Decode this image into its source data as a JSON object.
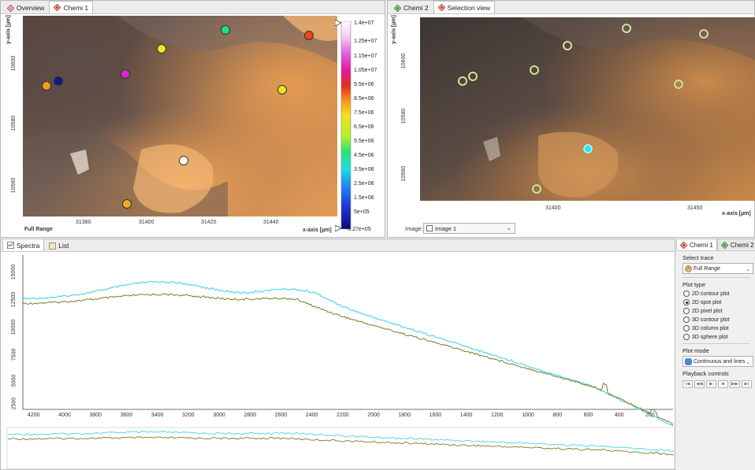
{
  "left_panel": {
    "tabs": [
      {
        "label": "Overview",
        "icon": "diamond-icon",
        "active": false
      },
      {
        "label": "Chemi 1",
        "icon": "diamond-red-icon",
        "active": true
      }
    ],
    "y_axis_title": "y-axis [µm]",
    "x_axis_title": "x-axis [µm]",
    "y_ticks": [
      "10600",
      "10580",
      "10560"
    ],
    "x_ticks": [
      "31380",
      "31400",
      "31420",
      "31440"
    ],
    "range_label": "Full Range"
  },
  "colorbar": {
    "labels": [
      "1.4e+07",
      "1.25e+07",
      "1.15e+07",
      "1.05e+07",
      "9.5e+06",
      "8.5e+06",
      "7.5e+06",
      "6.5e+06",
      "5.5e+06",
      "4.5e+06",
      "3.5e+06",
      "2.5e+06",
      "1.5e+06",
      "5e+05",
      "-8.27e+05"
    ]
  },
  "right_panel": {
    "tabs": [
      {
        "label": "Chemi 2",
        "icon": "diamond-green-icon",
        "active": false
      },
      {
        "label": "Selection view",
        "icon": "diamond-red-icon",
        "active": true
      }
    ],
    "y_axis_title": "y-axis [µm]",
    "x_axis_title": "x-axis [µm]",
    "y_ticks": [
      "10600",
      "10580",
      "10560"
    ],
    "x_ticks": [
      "31400",
      "31450"
    ],
    "image_label": "Image:",
    "image_select": "Image 1"
  },
  "spectra_panel": {
    "tabs": [
      {
        "label": "Spectra",
        "icon": "spectra-icon",
        "active": true
      },
      {
        "label": "List",
        "icon": "list-icon",
        "active": false
      }
    ],
    "y_ticks": [
      "15000",
      "12500",
      "10000",
      "7500",
      "5000",
      "2500"
    ],
    "x_ticks": [
      "4200",
      "4000",
      "3800",
      "3600",
      "3400",
      "3200",
      "3000",
      "2800",
      "2600",
      "2400",
      "2200",
      "2000",
      "1800",
      "1600",
      "1400",
      "1200",
      "1000",
      "800",
      "600",
      "400",
      "200"
    ]
  },
  "side_panel": {
    "tabs": [
      {
        "label": "Chemi 1",
        "icon": "diamond-red-icon",
        "active": true
      },
      {
        "label": "Chemi 2",
        "icon": "diamond-green-icon",
        "active": false
      }
    ],
    "select_trace_label": "Select trace",
    "select_trace_value": "Full Range",
    "plot_type_label": "Plot type",
    "plot_types": [
      {
        "label": "2D contour plot",
        "selected": false
      },
      {
        "label": "2D spot plot",
        "selected": true
      },
      {
        "label": "2D pixel plot",
        "selected": false
      },
      {
        "label": "3D contour plot",
        "selected": false
      },
      {
        "label": "3D column plot",
        "selected": false
      },
      {
        "label": "3D sphere plot",
        "selected": false
      }
    ],
    "plot_mode_label": "Plot mode",
    "plot_mode_value": "Continuous and lines",
    "playback_label": "Playback controls",
    "playback_buttons": [
      "first",
      "prev",
      "play",
      "stop",
      "next",
      "last"
    ]
  },
  "colors": {
    "spectrum_cyan": "#57d6e3",
    "spectrum_olive": "#7d7a24"
  }
}
